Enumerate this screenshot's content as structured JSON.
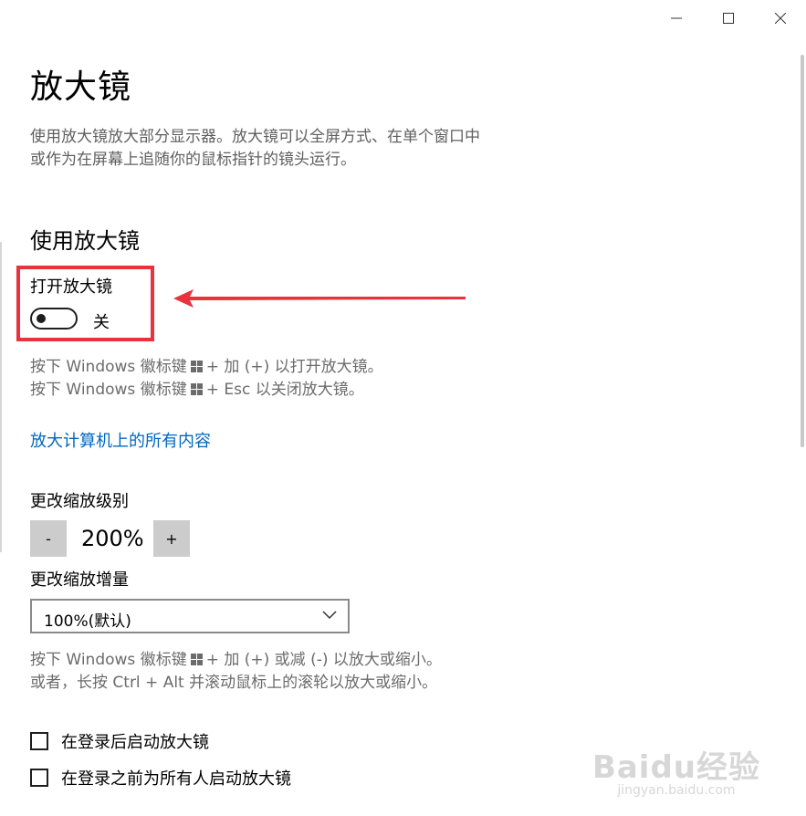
{
  "window": {
    "controls": [
      "minimize-icon",
      "maximize-icon",
      "close-icon"
    ]
  },
  "page": {
    "title": "放大镜",
    "description_line1": "使用放大镜放大部分显示器。放大镜可以全屏方式、在单个窗口中",
    "description_line2": "或作为在屏幕上追随你的鼠标指针的镜头运行。"
  },
  "section": {
    "heading": "使用放大镜"
  },
  "toggle": {
    "label": "打开放大镜",
    "state": "关",
    "on": false
  },
  "hints": {
    "open_prefix": "按下 Windows 徽标键",
    "open_suffix": "+ 加 (+) 以打开放大镜。",
    "close_prefix": "按下 Windows 徽标键",
    "close_suffix": "+ Esc 以关闭放大镜。"
  },
  "link": {
    "text": "放大计算机上的所有内容"
  },
  "zoom": {
    "label": "更改缩放级别",
    "minus_label": "-",
    "value": "200%",
    "plus_label": "+"
  },
  "increment": {
    "label": "更改缩放增量",
    "selected": "100%(默认)"
  },
  "hints2": {
    "line1_prefix": "按下 Windows 徽标键",
    "line1_suffix": "+ 加 (+) 或减 (-) 以放大或缩小。",
    "line2": "或者，长按 Ctrl + Alt 并滚动鼠标上的滚轮以放大或缩小。"
  },
  "checkboxes": [
    {
      "label": "在登录后启动放大镜",
      "checked": false
    },
    {
      "label": "在登录之前为所有人启动放大镜",
      "checked": false
    }
  ],
  "watermark": {
    "main": "Baidu经验",
    "sub": "jingyan.baidu.com"
  },
  "colors": {
    "highlight": "#e8323c",
    "link": "#0067c0",
    "button_bg": "#cccccc"
  }
}
